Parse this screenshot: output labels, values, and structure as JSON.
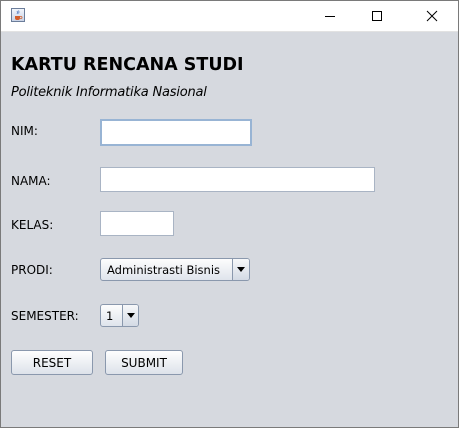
{
  "window": {
    "icon": "java-cup-icon",
    "controls": {
      "minimize": "minimize-icon",
      "maximize": "maximize-icon",
      "close": "close-icon"
    }
  },
  "form": {
    "title": "KARTU RENCANA STUDI",
    "subtitle": "Politeknik Informatika Nasional",
    "nim": {
      "label": "NIM:",
      "value": ""
    },
    "nama": {
      "label": "NAMA:",
      "value": ""
    },
    "kelas": {
      "label": "KELAS:",
      "value": ""
    },
    "prodi": {
      "label": "PRODI:",
      "selected": "Administrasti Bisnis"
    },
    "semester": {
      "label": "SEMESTER:",
      "selected": "1"
    },
    "buttons": {
      "reset": "RESET",
      "submit": "SUBMIT"
    }
  },
  "colors": {
    "background": "#d6d9df",
    "field_border": "#a9b4c4",
    "focus_border": "#98b4d4"
  }
}
